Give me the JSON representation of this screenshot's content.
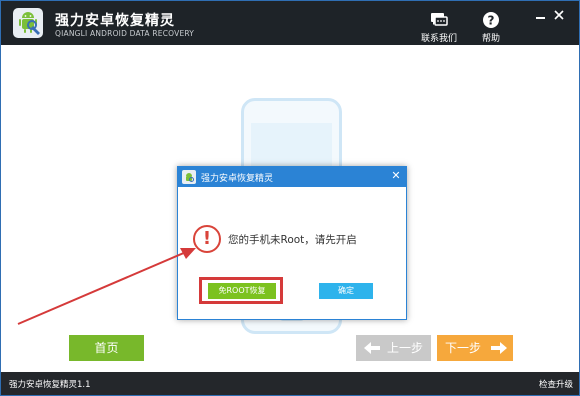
{
  "titlebar": {
    "title": "强力安卓恢复精灵",
    "subtitle": "QIANGLI ANDROID DATA RECOVERY",
    "contact_label": "联系我们",
    "help_label": "帮助",
    "help_icon_glyph": "?"
  },
  "dialog": {
    "title": "强力安卓恢复精灵",
    "close_glyph": "✕",
    "warning_glyph": "!",
    "message": "您的手机未Root，请先开启",
    "no_root_label": "免ROOT恢复",
    "ok_label": "确定"
  },
  "nav": {
    "home_label": "首页",
    "prev_label": "上一步",
    "next_label": "下一步"
  },
  "statusbar": {
    "version": "强力安卓恢复精灵1.1",
    "check_update": "检查升级"
  },
  "colors": {
    "titlebar_bg": "#1e2328",
    "dialog_accent": "#2b83d5",
    "highlight_red": "#d53a3a",
    "home_green": "#78b82b",
    "next_orange": "#f6a83c",
    "ok_blue": "#2eb3ec"
  },
  "icons": {
    "app_logo": "android-icon",
    "contact": "chat-icon",
    "help": "question-icon",
    "warning": "warning-icon"
  }
}
